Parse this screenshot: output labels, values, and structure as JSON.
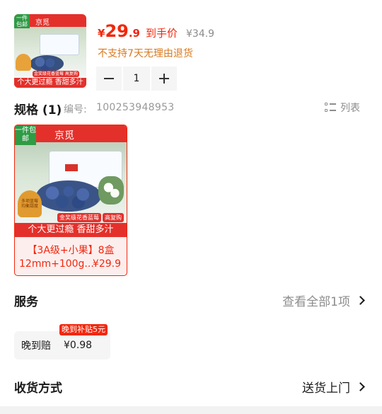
{
  "product": {
    "thumb": {
      "tag": "一件包邮",
      "brand": "京觅",
      "pill": "金奖级花香蓝莓 高复购",
      "banner": "个大更过瘾 香甜多汁"
    },
    "price": {
      "currency": "¥",
      "integer": "29",
      "decimal": ".9",
      "label": "到手价",
      "original": "¥34.9"
    },
    "return_policy": "不支持7天无理由退货"
  },
  "quantity": {
    "value": "1",
    "minus_icon": "minus-icon",
    "plus_icon": "plus-icon"
  },
  "spec": {
    "title": "规格 (1)",
    "code_label": "编号:",
    "code_value": "100253948953",
    "list_toggle_label": "列表",
    "list_icon": "list-view-icon",
    "selected_sku": {
      "image_tag": "一件包邮",
      "image_brand": "京觅",
      "image_pill_1": "金奖级花香蓝莓",
      "image_pill_2": "高复购",
      "image_medal": "多项蓝莓 均衡甜度",
      "image_banner": "个大更过瘾 香甜多汁",
      "name": "【3A级+小果】8盒",
      "sub": "12mm+100g...",
      "price": "¥29.9"
    }
  },
  "service": {
    "title": "服务",
    "link_label": "查看全部1项",
    "chip_label": "晚到赔",
    "chip_value": "¥0.98",
    "chip_badge": "晚到补贴5元"
  },
  "delivery": {
    "title": "收货方式",
    "value": "送货上门"
  },
  "colors": {
    "accent": "#f2270c",
    "warning": "#d9791e",
    "muted": "#8c8c8c"
  }
}
